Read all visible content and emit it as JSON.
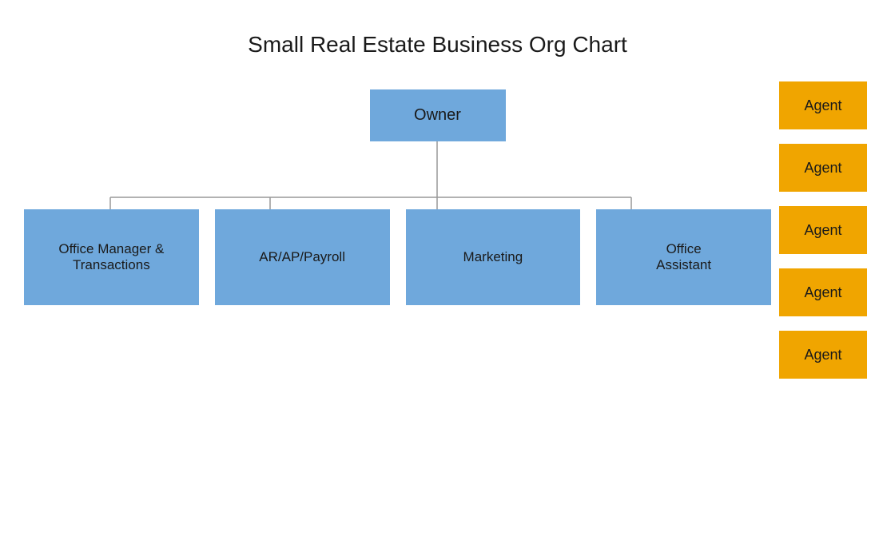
{
  "title": "Small Real Estate Business Org Chart",
  "owner": {
    "label": "Owner"
  },
  "children": [
    {
      "label": "Office Manager &\nTransactions"
    },
    {
      "label": "AR/AP/Payroll"
    },
    {
      "label": "Marketing"
    },
    {
      "label": "Office\nAssistant"
    }
  ],
  "agents": [
    {
      "label": "Agent"
    },
    {
      "label": "Agent"
    },
    {
      "label": "Agent"
    },
    {
      "label": "Agent"
    },
    {
      "label": "Agent"
    }
  ]
}
